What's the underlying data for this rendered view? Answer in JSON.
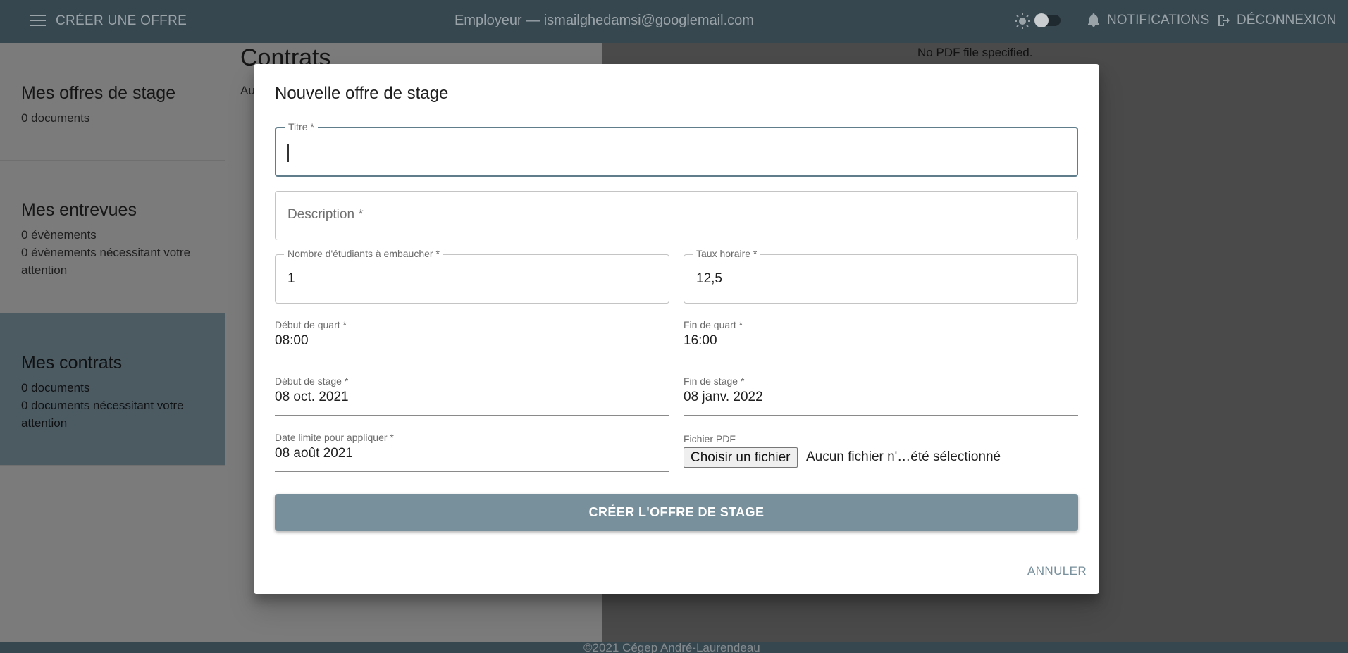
{
  "topbar": {
    "create_offer": "CRÉER UNE OFFRE",
    "user": "Employeur — ismailghedamsi@googlemail.com",
    "notifications": "NOTIFICATIONS",
    "logout": "DÉCONNEXION"
  },
  "sidebar": {
    "cards": [
      {
        "title": "Mes offres de stage",
        "lines": [
          "0 documents"
        ]
      },
      {
        "title": "Mes entrevues",
        "lines": [
          "0 évènements",
          "0 évènements nécessitant votre",
          "attention"
        ]
      },
      {
        "title": "Mes contrats",
        "lines": [
          "0 documents",
          "0 documents nécessitant votre",
          "attention"
        ]
      }
    ]
  },
  "main": {
    "title": "Contrats",
    "subtitle": "Au",
    "pdf_message": "No PDF file specified."
  },
  "footer": {
    "text": "©2021 Cégep André-Laurendeau"
  },
  "modal": {
    "title": "Nouvelle offre de stage",
    "fields": {
      "titre": {
        "label": "Titre *",
        "value": ""
      },
      "description": {
        "placeholder": "Description *"
      },
      "nombre": {
        "label": "Nombre d'étudiants à embaucher *",
        "value": "1"
      },
      "taux": {
        "label": "Taux horaire *",
        "value": "12,5"
      },
      "debut_quart": {
        "label": "Début de quart *",
        "value": "08:00"
      },
      "fin_quart": {
        "label": "Fin de quart *",
        "value": "16:00"
      },
      "debut_stage": {
        "label": "Début de stage *",
        "value": "08 oct. 2021"
      },
      "fin_stage": {
        "label": "Fin de stage *",
        "value": "08 janv. 2022"
      },
      "date_limite": {
        "label": "Date limite pour appliquer *",
        "value": "08 août 2021"
      },
      "fichier": {
        "label": "Fichier PDF",
        "button": "Choisir un fichier",
        "status": "Aucun fichier n'…été sélectionné"
      }
    },
    "submit": "CRÉER L'OFFRE DE STAGE",
    "cancel": "ANNULER"
  },
  "colors": {
    "appbar": "#37474f",
    "accent": "#78909c",
    "active_card": "#4c5a62"
  }
}
